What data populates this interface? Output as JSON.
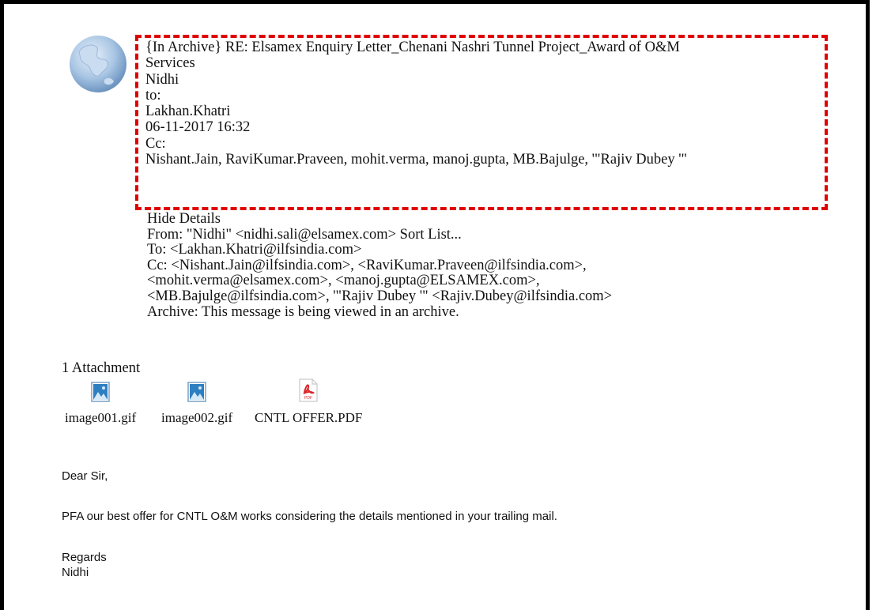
{
  "header": {
    "subject_line1": "{In Archive} RE: Elsamex Enquiry Letter_Chenani Nashri Tunnel Project_Award of O&M",
    "subject_line2": "Services",
    "sender_name": "Nidhi",
    "to_label": "to:",
    "recipient": "Lakhan.Khatri",
    "datetime": "06-11-2017 16:32",
    "cc_label": "Cc:",
    "cc_list": "Nishant.Jain, RaviKumar.Praveen, mohit.verma, manoj.gupta, MB.Bajulge, '\"Rajiv Dubey '\""
  },
  "details": {
    "hide_details": "Hide Details",
    "from_line": "From: \"Nidhi\" <nidhi.sali@elsamex.com> Sort List...",
    "to_line": "To: <Lakhan.Khatri@ilfsindia.com>",
    "cc_line1": "Cc: <Nishant.Jain@ilfsindia.com>, <RaviKumar.Praveen@ilfsindia.com>,",
    "cc_line2": "<mohit.verma@elsamex.com>, <manoj.gupta@ELSAMEX.com>,",
    "cc_line3": "<MB.Bajulge@ilfsindia.com>, '\"Rajiv Dubey '\" <Rajiv.Dubey@ilfsindia.com>",
    "archive_line": "Archive: This message is being viewed in an archive."
  },
  "attachments": {
    "count_label": "1 Attachment",
    "items": [
      {
        "name": "image001.gif",
        "icon": "image-file-icon"
      },
      {
        "name": "image002.gif",
        "icon": "image-file-icon"
      },
      {
        "name": "CNTL OFFER.PDF",
        "icon": "pdf-file-icon",
        "icon_text": "PDF"
      }
    ]
  },
  "body": {
    "greeting": "Dear Sir,",
    "message": "PFA our best offer for CNTL O&M works considering the details mentioned in your trailing mail.",
    "closing": "Regards",
    "signature": "Nidhi"
  },
  "colors": {
    "highlight_border": "#e00000",
    "avatar_blue": "#8fb4d8",
    "pdf_red": "#d9252a"
  }
}
